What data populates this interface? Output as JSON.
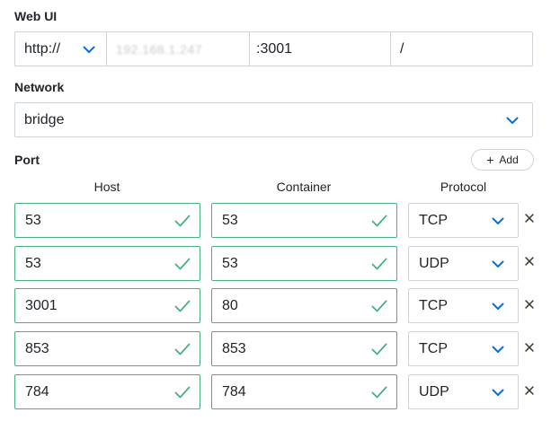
{
  "web_ui": {
    "label": "Web UI",
    "scheme": "http://",
    "host": "192.168.1.247",
    "port": ":3001",
    "path": "/"
  },
  "network": {
    "label": "Network",
    "value": "bridge"
  },
  "port": {
    "label": "Port",
    "add_label": "Add",
    "headers": {
      "host": "Host",
      "container": "Container",
      "protocol": "Protocol"
    },
    "rows": [
      {
        "host": "53",
        "container": "53",
        "protocol": "TCP"
      },
      {
        "host": "53",
        "container": "53",
        "protocol": "UDP"
      },
      {
        "host": "3001",
        "container": "80",
        "protocol": "TCP"
      },
      {
        "host": "853",
        "container": "853",
        "protocol": "TCP"
      },
      {
        "host": "784",
        "container": "784",
        "protocol": "UDP"
      }
    ]
  },
  "colors": {
    "accent": "#0a6ed8",
    "valid": "#48b27f",
    "border": "#ced4da"
  },
  "icons": {
    "dropdown": "chevron-down-icon",
    "valid": "check-icon",
    "remove": "close-icon",
    "add": "plus-icon"
  }
}
